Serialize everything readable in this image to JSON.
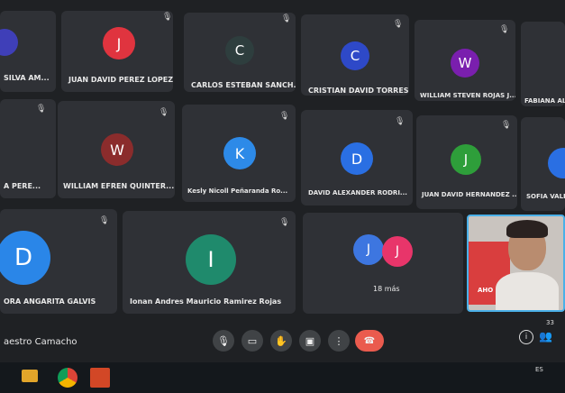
{
  "participants": [
    {
      "initial": "",
      "name": "SILVA AM...",
      "color": "#3f3fb8"
    },
    {
      "initial": "J",
      "name": "JUAN DAVID PEREZ LOPEZ",
      "color": "#e0343f"
    },
    {
      "initial": "C",
      "name": "CARLOS ESTEBAN SANCH...",
      "color": "#2e3e3e"
    },
    {
      "initial": "C",
      "name": "CRISTIAN DAVID TORRES ...",
      "color": "#2e49c8"
    },
    {
      "initial": "W",
      "name": "WILLIAM STEVEN ROJAS J...",
      "color": "#7a1fae"
    },
    {
      "initial": "",
      "name": "FABIANA ALEX",
      "color": "#4b3b3b"
    },
    {
      "initial": "",
      "name": "A PERE...",
      "color": "#333"
    },
    {
      "initial": "W",
      "name": "WILLIAM EFREN QUINTER...",
      "color": "#8b2c2c"
    },
    {
      "initial": "K",
      "name": "Kesly Nicoll Peñaranda Ro...",
      "color": "#2d8ae8"
    },
    {
      "initial": "D",
      "name": "DAVID ALEXANDER RODRI...",
      "color": "#2a6fe3"
    },
    {
      "initial": "J",
      "name": "JUAN DAVID HERNANDEZ ...",
      "color": "#2e9e3a"
    },
    {
      "initial": "",
      "name": "SOFIA VALEN",
      "color": "#2a6fe3"
    },
    {
      "initial": "D",
      "name": "ORA ANGARITA GALVIS",
      "color": "#2a86e8"
    },
    {
      "initial": "I",
      "name": "Ionan Andres Mauricio Ramirez Rojas",
      "color": "#1f8a6c"
    }
  ],
  "more_tile": {
    "initials": [
      "J",
      "J"
    ],
    "label": "18 más",
    "colors": [
      "#3d76e0",
      "#e8356a"
    ]
  },
  "self_tile": {
    "banner": "AHO"
  },
  "bottom_bar": {
    "meeting_name": "aestro Camacho",
    "participant_count": "33"
  },
  "taskbar": {
    "language": "ES"
  }
}
